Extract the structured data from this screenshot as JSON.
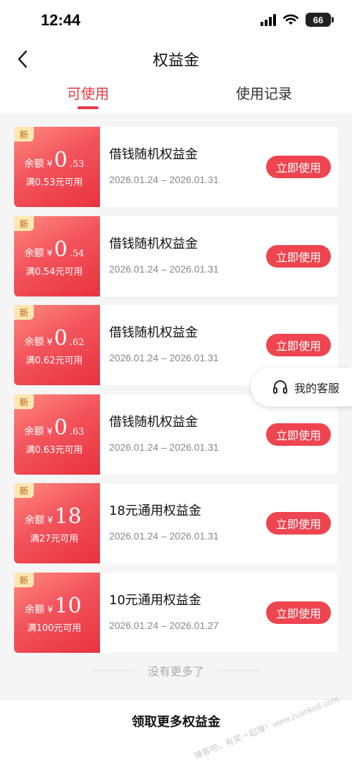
{
  "status_bar": {
    "time": "12:44",
    "battery": "66"
  },
  "nav": {
    "title": "权益金"
  },
  "tabs": [
    {
      "label": "可使用",
      "active": true
    },
    {
      "label": "使用记录",
      "active": false
    }
  ],
  "coupons": [
    {
      "tag": "新",
      "amount_label": "余额",
      "currency": "¥",
      "amount_int": "0",
      "amount_dec": ".53",
      "threshold": "满0.53元可用",
      "title": "借钱随机权益金",
      "date_range": "2026.01.24 – 2026.01.31",
      "button": "立即使用"
    },
    {
      "tag": "新",
      "amount_label": "余额",
      "currency": "¥",
      "amount_int": "0",
      "amount_dec": ".54",
      "threshold": "满0.54元可用",
      "title": "借钱随机权益金",
      "date_range": "2026.01.24 – 2026.01.31",
      "button": "立即使用"
    },
    {
      "tag": "新",
      "amount_label": "余额",
      "currency": "¥",
      "amount_int": "0",
      "amount_dec": ".62",
      "threshold": "满0.62元可用",
      "title": "借钱随机权益金",
      "date_range": "2026.01.24 – 2026.01.31",
      "button": "立即使用"
    },
    {
      "tag": "新",
      "amount_label": "余额",
      "currency": "¥",
      "amount_int": "0",
      "amount_dec": ".63",
      "threshold": "满0.63元可用",
      "title": "借钱随机权益金",
      "date_range": "2026.01.24 – 2026.01.31",
      "button": "立即使用"
    },
    {
      "tag": "新",
      "amount_label": "余额",
      "currency": "¥",
      "amount_int": "18",
      "amount_dec": "",
      "threshold": "满27元可用",
      "title": "18元通用权益金",
      "date_range": "2026.01.24 – 2026.01.31",
      "button": "立即使用"
    },
    {
      "tag": "新",
      "amount_label": "余额",
      "currency": "¥",
      "amount_int": "10",
      "amount_dec": "",
      "threshold": "满100元可用",
      "title": "10元通用权益金",
      "date_range": "2026.01.24 – 2026.01.27",
      "button": "立即使用"
    }
  ],
  "service": {
    "label": "我的客服",
    "icon": "headset-icon"
  },
  "footer": {
    "no_more": "没有更多了",
    "bottom_link": "领取更多权益金",
    "watermark": "赚客吧，有奖一起赚！www.zuanke8.com"
  },
  "colors": {
    "accent": "#e83a44",
    "button": "#ee4550",
    "tag_bg": "#ffe8b0"
  }
}
